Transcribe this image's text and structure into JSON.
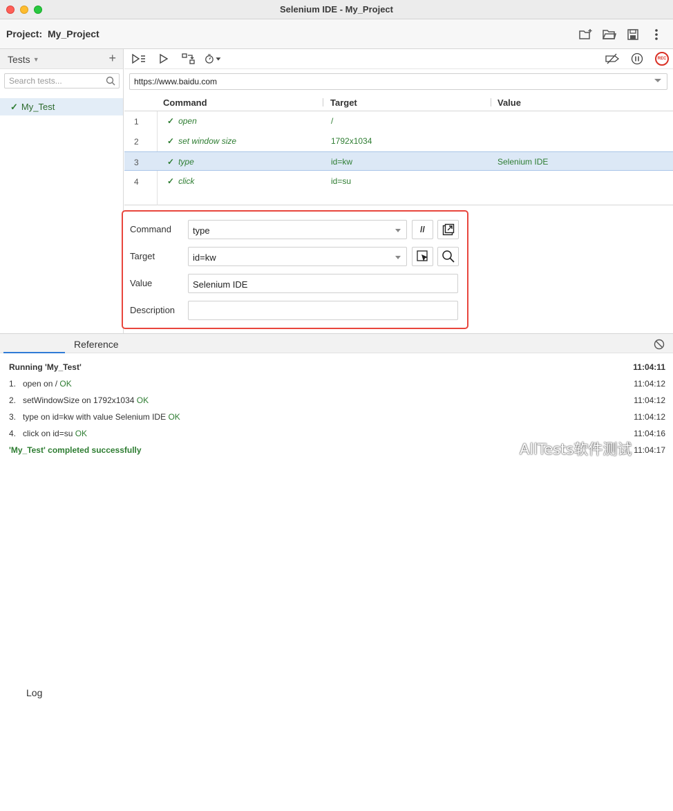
{
  "window": {
    "title": "Selenium IDE - My_Project"
  },
  "project": {
    "label": "Project:",
    "name": "My_Project",
    "icons": [
      "new-project-icon",
      "open-folder-icon",
      "save-icon",
      "more-icon"
    ]
  },
  "sidebar": {
    "title": "Tests",
    "add_label": "+",
    "search_placeholder": "Search tests...",
    "tests": [
      {
        "name": "My_Test",
        "status": "passed"
      }
    ]
  },
  "toolbar": {
    "left_icons": [
      "run-all-icon",
      "run-test-icon",
      "step-over-icon",
      "speed-icon"
    ],
    "right_icons": [
      "disable-breakpoints-icon",
      "pause-icon",
      "record-icon"
    ],
    "rec_label": "REC"
  },
  "url": {
    "value": "https://www.baidu.com"
  },
  "commands": {
    "headers": {
      "command": "Command",
      "target": "Target",
      "value": "Value"
    },
    "rows": [
      {
        "num": "1",
        "command": "open",
        "target": "/",
        "value": ""
      },
      {
        "num": "2",
        "command": "set window size",
        "target": "1792x1034",
        "value": ""
      },
      {
        "num": "3",
        "command": "type",
        "target": "id=kw",
        "value": "Selenium IDE"
      },
      {
        "num": "4",
        "command": "click",
        "target": "id=su",
        "value": ""
      }
    ],
    "selected_row": 3
  },
  "editor": {
    "command_label": "Command",
    "command_value": "type",
    "comment_button": "//",
    "target_label": "Target",
    "target_value": "id=kw",
    "value_label": "Value",
    "value_value": "Selenium IDE",
    "description_label": "Description",
    "description_value": ""
  },
  "bottom": {
    "tabs": [
      "Log",
      "Reference"
    ],
    "active_tab": "Log"
  },
  "log": {
    "header": {
      "text": "Running 'My_Test'",
      "time": "11:04:11"
    },
    "entries": [
      {
        "num": "1.",
        "text": "open on /",
        "status": "OK",
        "time": "11:04:12"
      },
      {
        "num": "2.",
        "text": "setWindowSize on 1792x1034",
        "status": "OK",
        "time": "11:04:12"
      },
      {
        "num": "3.",
        "text": "type on id=kw with value Selenium IDE",
        "status": "OK",
        "time": "11:04:12"
      },
      {
        "num": "4.",
        "text": "click on id=su",
        "status": "OK",
        "time": "11:04:16"
      }
    ],
    "footer": {
      "text": "'My_Test' completed successfully",
      "time": "11:04:17"
    }
  },
  "watermark": {
    "text": "AllTests软件测试"
  },
  "colors": {
    "pass": "#2e7d32",
    "highlight": "#e8453c",
    "selected_row": "#dce8f6",
    "accent": "#2f7bd6"
  }
}
